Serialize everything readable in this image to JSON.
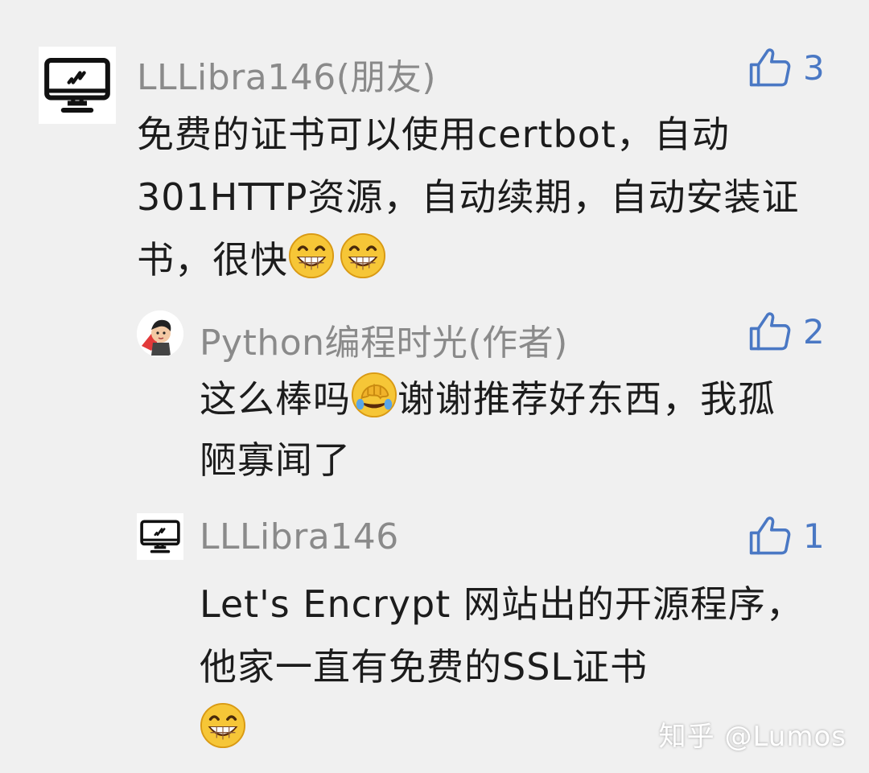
{
  "comments": [
    {
      "username": "LLLibra146(朋友)",
      "text": "免费的证书可以使用certbot，自动301HTTP资源，自动续期，自动安装证书，很快",
      "likes": "3"
    },
    {
      "username": "Python编程时光(作者)",
      "text_part1": "这么棒吗",
      "text_part2": "谢谢推荐好东西，我孤陋寡闻了",
      "likes": "2"
    },
    {
      "username": "LLLibra146",
      "text": "Let's Encrypt 网站出的开源程序，他家一直有免费的SSL证书",
      "likes": "1"
    }
  ],
  "watermark": "知乎 @Lumos",
  "colors": {
    "like": "#4a78c4",
    "username": "#8a8a8a",
    "text": "#1c1c1c",
    "background": "#f0f0f0"
  },
  "icons": [
    "monitor-icon",
    "thumbs-up-icon",
    "grin-emoji-icon",
    "facepalm-emoji-icon"
  ]
}
